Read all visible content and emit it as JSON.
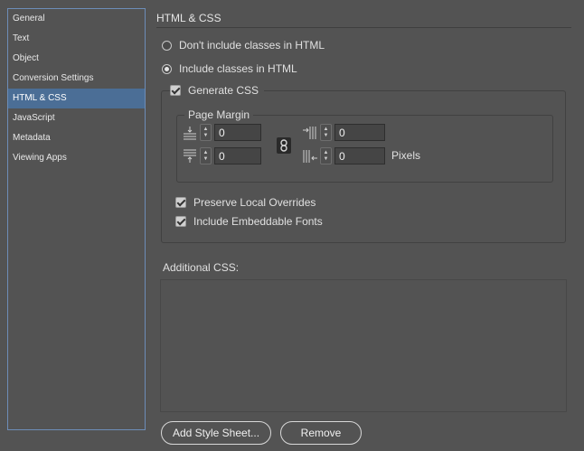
{
  "sidebar": {
    "items": [
      {
        "label": "General"
      },
      {
        "label": "Text"
      },
      {
        "label": "Object"
      },
      {
        "label": "Conversion Settings"
      },
      {
        "label": "HTML & CSS"
      },
      {
        "label": "JavaScript"
      },
      {
        "label": "Metadata"
      },
      {
        "label": "Viewing Apps"
      }
    ],
    "active_index": 4
  },
  "main": {
    "title": "HTML & CSS",
    "classes": {
      "option_none": "Don't include classes in HTML",
      "option_include": "Include classes in HTML",
      "selected": "option_include"
    },
    "generate_css": {
      "label": "Generate CSS",
      "checked": true,
      "page_margin": {
        "label": "Page Margin",
        "top": "0",
        "bottom": "0",
        "left": "0",
        "right": "0",
        "unit": "Pixels",
        "icons": {
          "top": "margin-top-icon",
          "bottom": "margin-bottom-icon",
          "left": "margin-left-icon",
          "right": "margin-right-icon",
          "link": "chain-link-icon"
        }
      },
      "preserve_overrides": {
        "label": "Preserve Local Overrides",
        "checked": true
      },
      "embeddable_fonts": {
        "label": "Include Embeddable Fonts",
        "checked": true
      }
    },
    "additional_css": {
      "label": "Additional CSS:",
      "value": ""
    },
    "buttons": {
      "add_style_sheet": "Add Style Sheet...",
      "remove": "Remove"
    }
  },
  "colors": {
    "background": "#535353",
    "sidebar_selected": "#4b6e96",
    "sidebar_border": "#6d8db8"
  }
}
